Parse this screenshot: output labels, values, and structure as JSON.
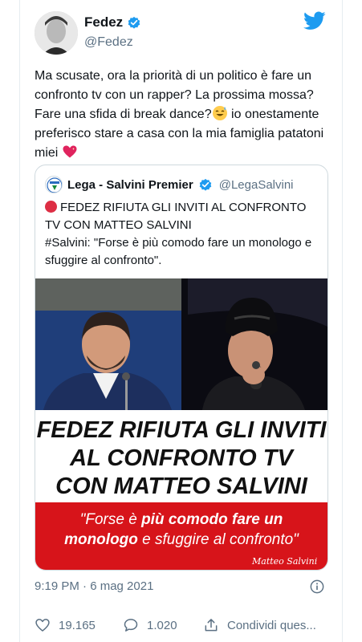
{
  "author": {
    "name": "Fedez",
    "handle": "@Fedez"
  },
  "icons": {
    "verified": "verified-badge-icon",
    "brand": "twitter-bird-icon",
    "like": "heart-icon",
    "reply": "reply-bubble-icon",
    "share": "share-icon",
    "info": "info-icon"
  },
  "colors": {
    "accent": "#1d9bf0",
    "secondary_text": "#5b7083",
    "banner_red": "#d7141a"
  },
  "tweet": {
    "text_part1": "Ma scusate, ora la priorità di un politico è fare un confronto tv con un rapper? La prossima mossa? Fare una sfida di break dance?",
    "text_part2": " io onestamente preferisco stare a casa con la mia famiglia patatoni miei ",
    "timestamp": "9:19 PM · 6 mag 2021"
  },
  "quoted": {
    "name": "Lega - Salvini Premier",
    "handle": "@LegaSalvini",
    "text_line1": "FEDEZ RIFIUTA GLI INVITI AL CONFRONTO TV CON MATTEO SALVINI",
    "text_line2": "#Salvini: \"Forse è più comodo fare un monologo e sfuggire al confronto\".",
    "image": {
      "headline_line1": "FEDEZ RIFIUTA GLI INVITI",
      "headline_line2": "AL CONFRONTO TV",
      "headline_line3": "CON MATTEO SALVINI",
      "quote_part_a": "\"Forse è ",
      "quote_part_b": "più comodo fare un",
      "quote_part_c": "monologo",
      "quote_part_d": " e sfuggire al confronto\"",
      "signature": "Matteo Salvini"
    }
  },
  "actions": {
    "like_count": "19.165",
    "reply_count": "1.020",
    "share_label": "Condividi ques..."
  }
}
